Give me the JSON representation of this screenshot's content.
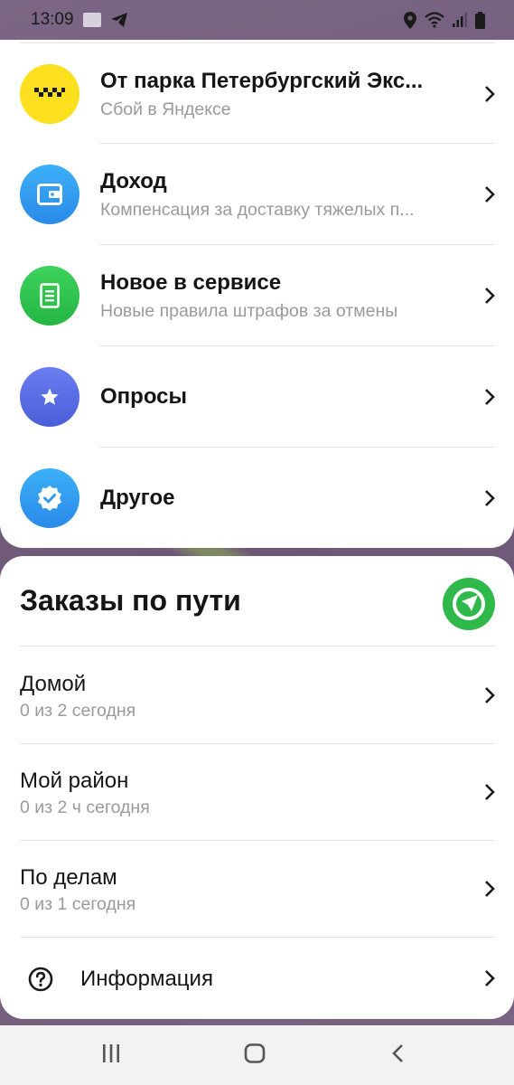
{
  "status_bar": {
    "time": "13:09"
  },
  "categories": [
    {
      "title": "От парка Петербургский Экс...",
      "subtitle": "Сбой в Яндексе",
      "icon": "taxi-checker-icon",
      "color": "#fcdf1f"
    },
    {
      "title": "Доход",
      "subtitle": "Компенсация за доставку тяжелых п...",
      "icon": "wallet-icon",
      "color": "#2f9bf0"
    },
    {
      "title": "Новое в сервисе",
      "subtitle": "Новые правила штрафов за отмены",
      "icon": "document-icon",
      "color": "#2ec74e"
    },
    {
      "title": "Опросы",
      "subtitle": "",
      "icon": "star-icon",
      "color": "#5a6fe6"
    },
    {
      "title": "Другое",
      "subtitle": "",
      "icon": "verified-badge-icon",
      "color": "#2f9bf0"
    }
  ],
  "route_section": {
    "title": "Заказы по пути",
    "items": [
      {
        "title": "Домой",
        "subtitle": "0 из 2 сегодня"
      },
      {
        "title": "Мой район",
        "subtitle": "0 из 2 ч сегодня"
      },
      {
        "title": "По делам",
        "subtitle": "0 из 1 сегодня"
      }
    ],
    "info_label": "Информация"
  }
}
